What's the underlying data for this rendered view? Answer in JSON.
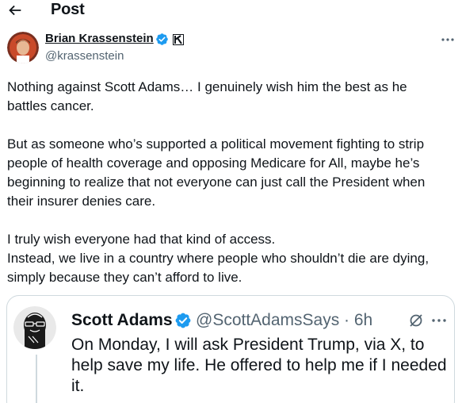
{
  "header": {
    "back_icon": "arrow-left-icon",
    "title": "Post"
  },
  "post": {
    "author_name": "Brian Krassenstein",
    "handle": "@krassenstein",
    "verified_icon": "verified-badge-icon",
    "affiliation_icon": "affiliation-badge-icon",
    "more_icon": "more-horizontal-icon",
    "lines": [
      "Nothing against Scott Adams… I genuinely wish him the best as he",
      "battles cancer.",
      "",
      "But as someone who’s supported a political movement fighting to strip",
      "people of health coverage and opposing Medicare for All, maybe he’s",
      "beginning to realize that not everyone can just call the President when",
      "their insurer denies care.",
      "",
      "I truly wish everyone had that kind of access.",
      "Instead, we live in a country where people who shouldn’t die are dying,",
      "simply because they can’t afford to live."
    ]
  },
  "quote": {
    "author_name": "Scott Adams",
    "handle_time": "@ScottAdamsSays · 6h",
    "verified_icon": "verified-badge-icon",
    "grok_icon": "grok-icon",
    "more_icon": "more-horizontal-icon",
    "lines": [
      "On Monday, I will ask President Trump, via X, to",
      "help save my life. He offered to help me if I needed",
      "it."
    ]
  },
  "colors": {
    "text": "#0f1419",
    "secondary": "#536471",
    "verified": "#1d9bf0",
    "border": "#cfd9de"
  }
}
